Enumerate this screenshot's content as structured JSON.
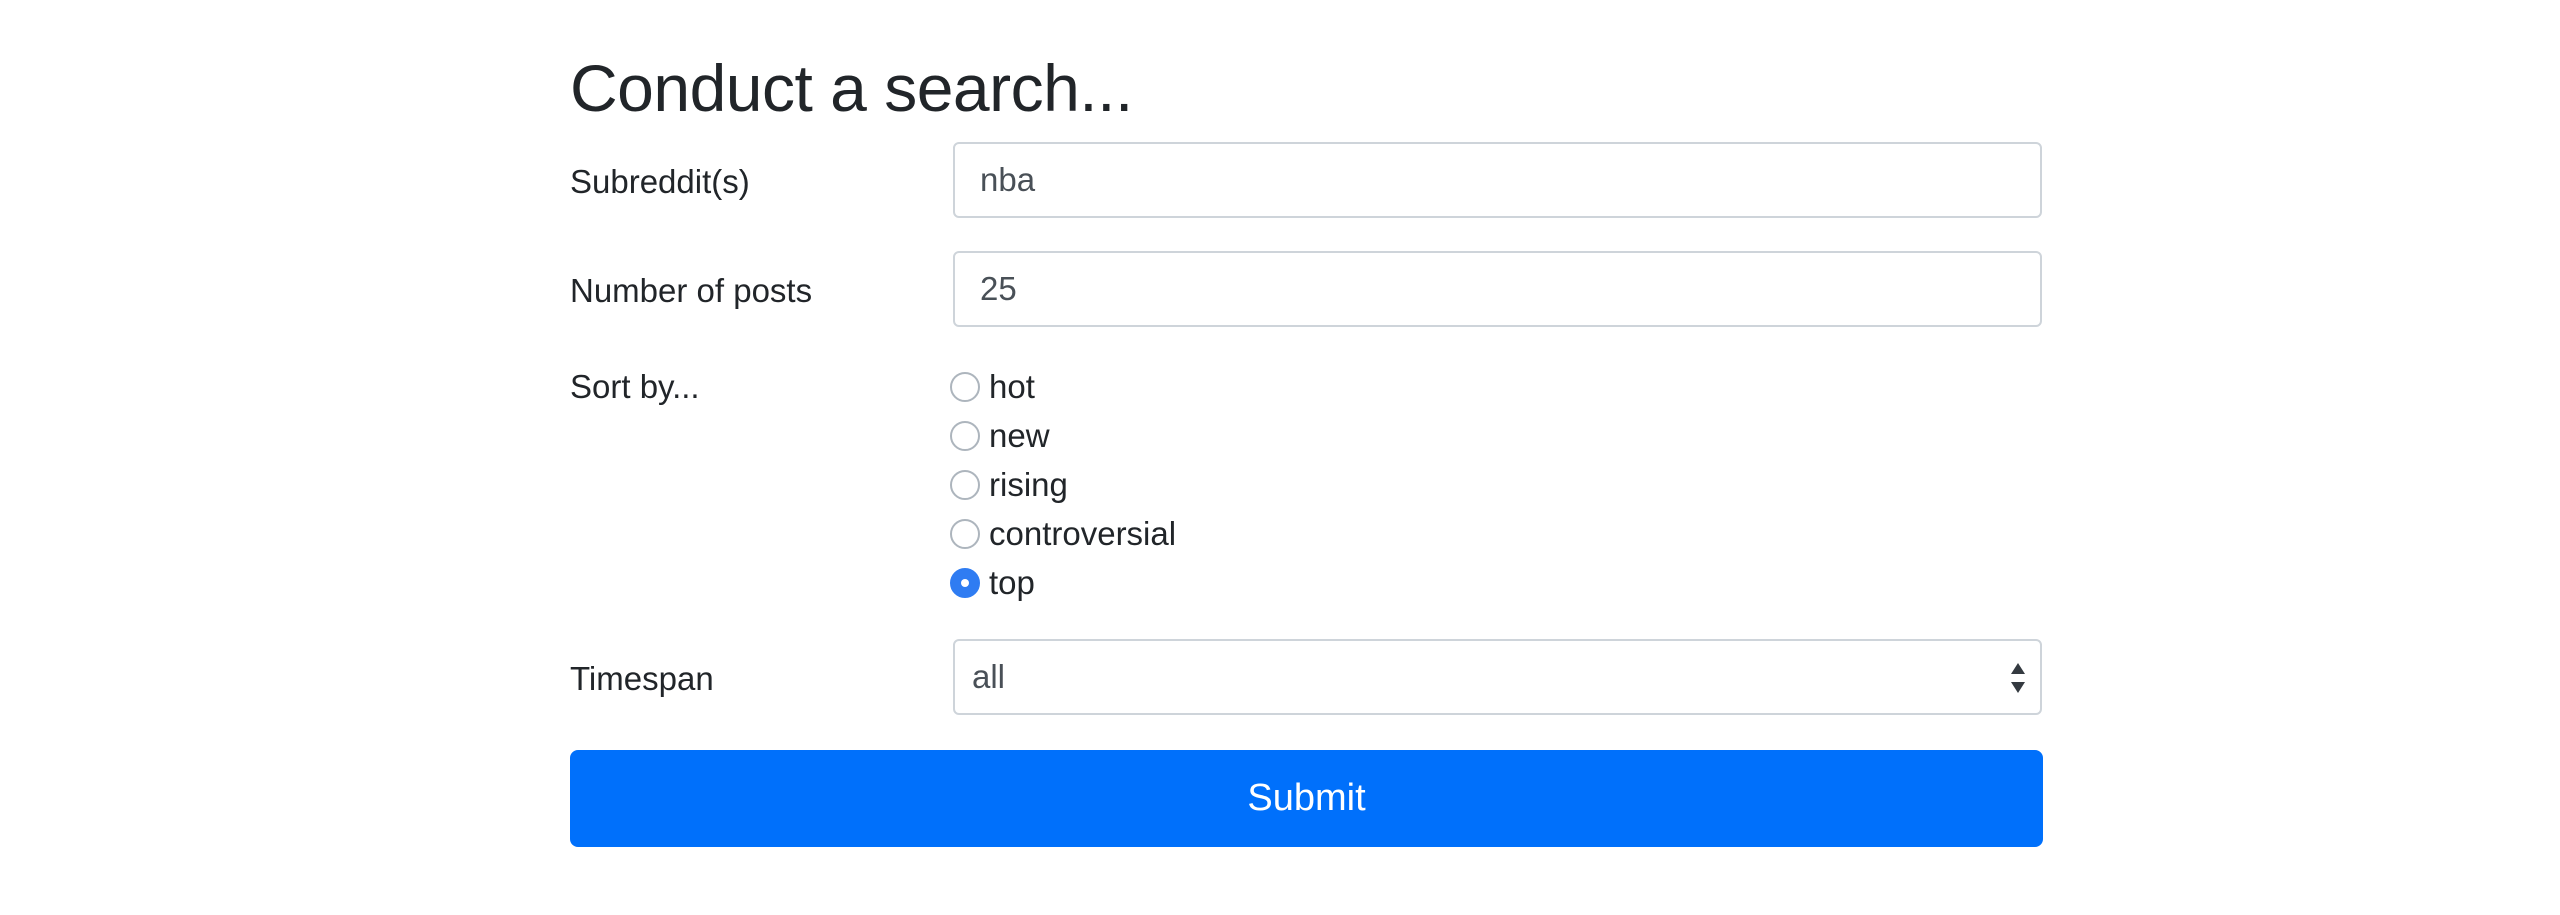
{
  "page": {
    "title": "Conduct a search..."
  },
  "form": {
    "subreddit": {
      "label": "Subreddit(s)",
      "value": "nba"
    },
    "num_posts": {
      "label": "Number of posts",
      "value": "25"
    },
    "sort": {
      "label": "Sort by...",
      "options": [
        {
          "label": "hot",
          "checked": false
        },
        {
          "label": "new",
          "checked": false
        },
        {
          "label": "rising",
          "checked": false
        },
        {
          "label": "controversial",
          "checked": false
        },
        {
          "label": "top",
          "checked": true
        }
      ]
    },
    "timespan": {
      "label": "Timespan",
      "selected": "all"
    },
    "submit_label": "Submit"
  },
  "colors": {
    "primary": "#0070fb",
    "radio_checked": "#2f7cf2",
    "border": "#ced4da",
    "text": "#212529"
  },
  "icons": {
    "select_arrows": "sort-arrows-icon"
  }
}
